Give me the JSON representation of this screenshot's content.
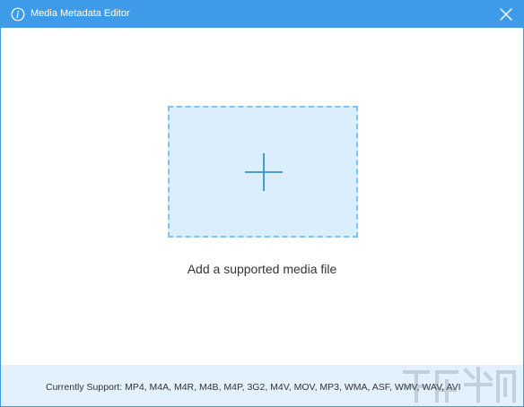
{
  "window": {
    "title": "Media Metadata Editor"
  },
  "icons": {
    "info": "info-icon",
    "close": "close-icon",
    "plus": "plus-icon"
  },
  "drop_zone": {
    "label": "Add a supported media file"
  },
  "footer": {
    "support_text": "Currently Support: MP4, M4A, M4R, M4B, M4P, 3G2, M4V, MOV, MP3, WMA, ASF, WMV, WAV, AVI"
  },
  "colors": {
    "accent": "#3d9be9",
    "drop_zone_fill": "#dbeefd",
    "drop_zone_border": "#83c2ee",
    "footer_bg": "#e2f1fc"
  }
}
